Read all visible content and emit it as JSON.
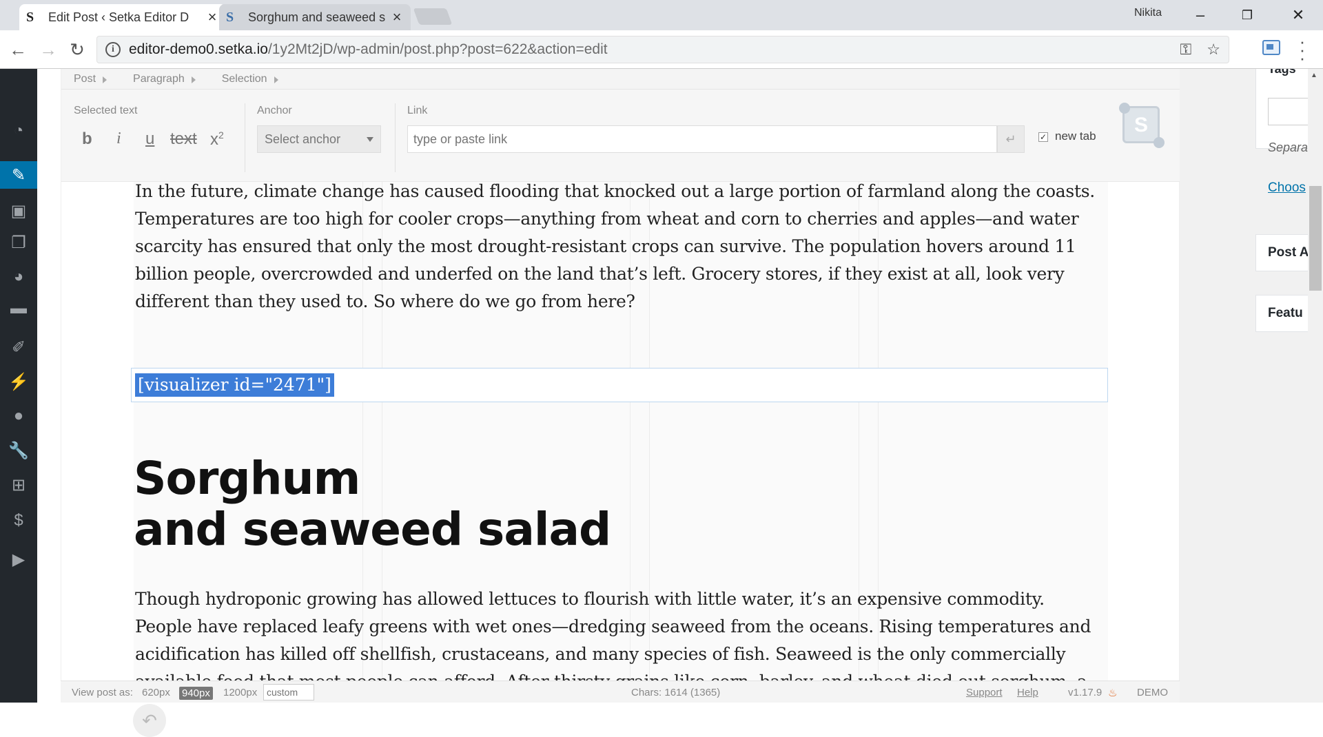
{
  "browser": {
    "tabs": [
      {
        "title": "Edit Post ‹ Setka Editor D",
        "favicon": "setka-s-icon",
        "active": true
      },
      {
        "title": "Sorghum and seaweed s",
        "favicon": "setka-s-icon",
        "active": false
      }
    ],
    "profile_name": "Nikita",
    "url_host": "editor-demo0.setka.io",
    "url_path": "/1y2Mt2jD/wp-admin/post.php?post=622&action=edit"
  },
  "editor": {
    "breadcrumbs": [
      "Post",
      "Paragraph",
      "Selection"
    ],
    "toolbar": {
      "selected_text_label": "Selected text",
      "bold": "b",
      "italic": "i",
      "underline": "u",
      "strike": "text",
      "superscript_base": "x",
      "superscript_exp": "2",
      "anchor_label": "Anchor",
      "anchor_value": "Select anchor",
      "link_label": "Link",
      "link_placeholder": "type or paste link",
      "new_tab_label": "new tab",
      "new_tab_checked": true,
      "logo_letter": "S"
    },
    "content": {
      "paragraph1": [
        "In the future, climate change has caused flooding that knocked out a large portion of farmland along the coasts.",
        "Temperatures are too high for cooler crops—anything from wheat and corn to cherries and apples—and water",
        "scarcity has ensured that only the most drought-resistant crops can survive. The population hovers around 11",
        "billion people, overcrowded and underfed on the land that’s left. Grocery stores, if they exist at all, look very",
        "different than they used to. So where do we go from here?"
      ],
      "shortcode": "[visualizer id=\"2471\"]",
      "heading_line1": "Sorghum",
      "heading_line2": "and seaweed salad",
      "paragraph2": [
        "Though hydroponic growing has allowed lettuces to flourish with little water, it’s an expensive commodity.",
        "People have replaced leafy greens with wet ones—dredging seaweed from the oceans. Rising temperatures and",
        "acidification has killed off shellfish, crustaceans, and many species of fish. Seaweed is the only commercially",
        "available food that most people can afford. After thirsty grains like corn, barley, and wheat died out sorghum, a"
      ]
    },
    "statusbar": {
      "view_as_label": "View post as:",
      "viewports": [
        "620px",
        "940px",
        "1200px"
      ],
      "active_viewport": "940px",
      "custom_placeholder": "custom",
      "chars": "Chars: 1614 (1365)",
      "support": "Support",
      "help": "Help",
      "version": "v1.17.9",
      "mode": "DEMO"
    }
  },
  "right_panel": {
    "tags_title": "Tags",
    "separate_hint": "Separa",
    "choose_link": "Choos",
    "post_attributes_title": "Post A",
    "featured_title": "Featu"
  },
  "colors": {
    "wp_sidebar": "#23282d",
    "wp_active": "#0073aa",
    "selection": "#3d7dd8"
  }
}
